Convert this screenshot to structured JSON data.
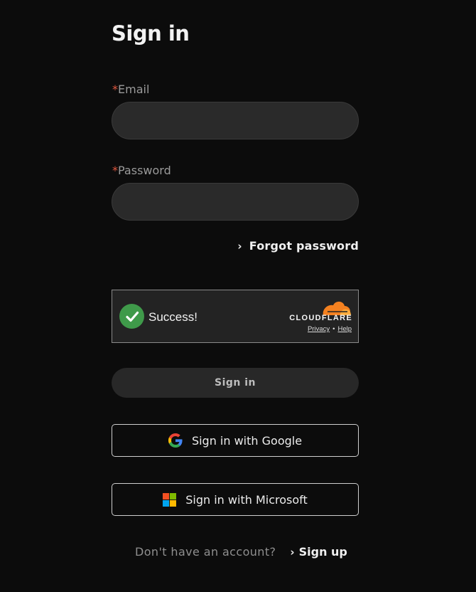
{
  "page": {
    "title": "Sign in"
  },
  "form": {
    "required_marker": "*",
    "email": {
      "label": "Email",
      "value": "",
      "placeholder": ""
    },
    "password": {
      "label": "Password",
      "value": "",
      "placeholder": ""
    },
    "forgot_password": {
      "icon": "chevron-right-icon",
      "label": "Forgot password"
    },
    "submit_label": "Sign in"
  },
  "captcha": {
    "status": "Success!",
    "status_icon": "check-circle-icon",
    "provider": "CLOUDFLARE",
    "privacy_label": "Privacy",
    "separator": "•",
    "help_label": "Help",
    "colors": {
      "success": "#3f9a4a",
      "brand_orange": "#f48120",
      "brand_light_orange": "#faad3f"
    }
  },
  "oauth": {
    "google": {
      "icon": "google-icon",
      "label": "Sign in with Google"
    },
    "microsoft": {
      "icon": "microsoft-icon",
      "label": "Sign in with Microsoft"
    }
  },
  "footer": {
    "prompt": "Don't have an account?",
    "signup_icon": "chevron-right-icon",
    "signup_label": "Sign up"
  },
  "colors": {
    "background": "#0c0c0c",
    "required": "#e0573f",
    "input_bg": "#2a2a2a"
  }
}
